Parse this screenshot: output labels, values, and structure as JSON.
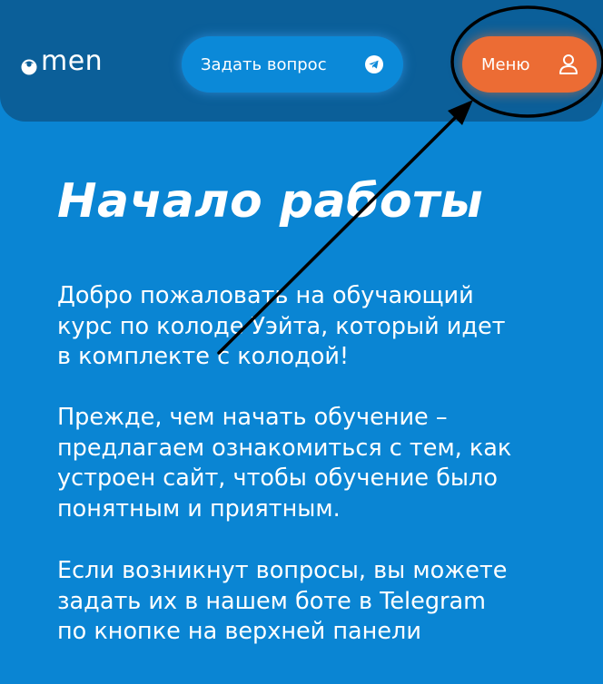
{
  "header": {
    "logo_text": "men",
    "ask_button_label": "Задать вопрос",
    "ask_button_icon": "telegram-icon",
    "menu_button_label": "Меню",
    "menu_button_icon": "user-icon"
  },
  "main": {
    "title": "Начало работы",
    "paragraphs": [
      "Добро пожаловать на обучающий\nкурс по колоде Уэйта, который идет\nв комплекте с колодой!",
      "Прежде, чем начать обучение –\nпредлагаем ознакомиться с тем, как\nустроен сайт, чтобы обучение было\nпонятным и приятным.",
      "Если возникнут вопросы, вы можете\nзадать их в нашем боте в Telegram\nпо кнопке на верхней панели"
    ]
  },
  "colors": {
    "background": "#0a85d3",
    "header_background": "#0b5f99",
    "ask_button": "#0b89d8",
    "menu_button": "#ec6c34",
    "text": "#ffffff",
    "annotation": "#000000"
  }
}
